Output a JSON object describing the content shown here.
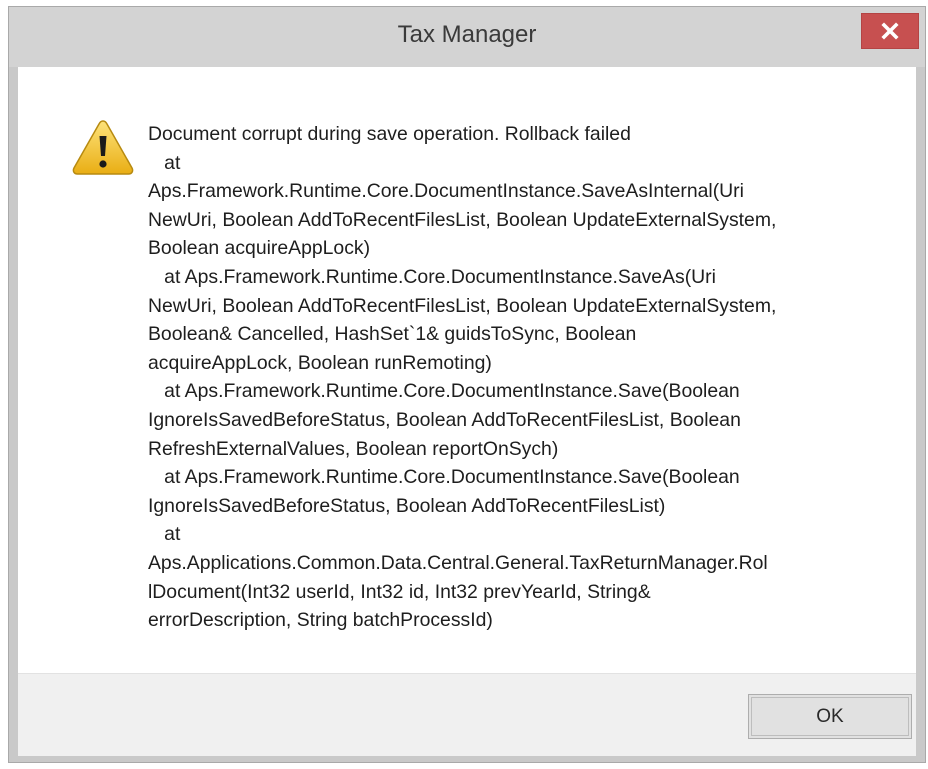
{
  "window": {
    "title": "Tax Manager",
    "close_icon": "close-icon"
  },
  "dialog": {
    "icon": "warning-icon",
    "message": "Document corrupt during save operation. Rollback failed\n   at\nAps.Framework.Runtime.Core.DocumentInstance.SaveAsInternal(Uri\nNewUri, Boolean AddToRecentFilesList, Boolean UpdateExternalSystem,\nBoolean acquireAppLock)\n   at Aps.Framework.Runtime.Core.DocumentInstance.SaveAs(Uri\nNewUri, Boolean AddToRecentFilesList, Boolean UpdateExternalSystem,\nBoolean& Cancelled, HashSet`1& guidsToSync, Boolean\nacquireAppLock, Boolean runRemoting)\n   at Aps.Framework.Runtime.Core.DocumentInstance.Save(Boolean\nIgnoreIsSavedBeforeStatus, Boolean AddToRecentFilesList, Boolean\nRefreshExternalValues, Boolean reportOnSych)\n   at Aps.Framework.Runtime.Core.DocumentInstance.Save(Boolean\nIgnoreIsSavedBeforeStatus, Boolean AddToRecentFilesList)\n   at\nAps.Applications.Common.Data.Central.General.TaxReturnManager.Rol\nlDocument(Int32 userId, Int32 id, Int32 prevYearId, String&\nerrorDescription, String batchProcessId)",
    "ok_label": "OK"
  },
  "colors": {
    "close_button": "#c75050",
    "titlebar": "#d3d3d3",
    "footer": "#f0f0f0",
    "warning_fill": "#f3c21e"
  }
}
